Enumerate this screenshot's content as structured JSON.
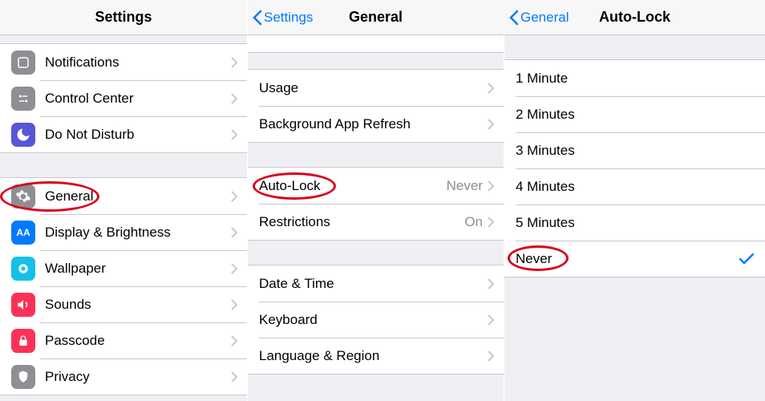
{
  "pane1": {
    "title": "Settings",
    "group1": [
      {
        "icon": "notifications-icon",
        "bg": "#fe3b30",
        "glyph_bg": "#8e8e93",
        "label": "Notifications"
      },
      {
        "icon": "control-center-icon",
        "bg": "#8e8e93",
        "label": "Control Center"
      },
      {
        "icon": "dnd-icon",
        "bg": "#5856d6",
        "label": "Do Not Disturb"
      }
    ],
    "group2": [
      {
        "icon": "general-icon",
        "bg": "#8e8e93",
        "label": "General",
        "circled": true
      },
      {
        "icon": "display-icon",
        "bg": "#007aff",
        "label": "Display & Brightness"
      },
      {
        "icon": "wallpaper-icon",
        "bg": "#14c0e8",
        "label": "Wallpaper"
      },
      {
        "icon": "sounds-icon",
        "bg": "#fc3158",
        "label": "Sounds"
      },
      {
        "icon": "passcode-icon",
        "bg": "#fc3158",
        "label": "Passcode"
      },
      {
        "icon": "privacy-icon",
        "bg": "#8e8e93",
        "label": "Privacy"
      }
    ]
  },
  "pane2": {
    "back": "Settings",
    "title": "General",
    "group1": [
      {
        "label": "Usage"
      },
      {
        "label": "Background App Refresh"
      }
    ],
    "group2": [
      {
        "label": "Auto-Lock",
        "value": "Never",
        "circled": true
      },
      {
        "label": "Restrictions",
        "value": "On"
      }
    ],
    "group3": [
      {
        "label": "Date & Time"
      },
      {
        "label": "Keyboard"
      },
      {
        "label": "Language & Region"
      }
    ]
  },
  "pane3": {
    "back": "General",
    "title": "Auto-Lock",
    "options": [
      {
        "label": "1 Minute",
        "selected": false
      },
      {
        "label": "2 Minutes",
        "selected": false
      },
      {
        "label": "3 Minutes",
        "selected": false
      },
      {
        "label": "4 Minutes",
        "selected": false
      },
      {
        "label": "5 Minutes",
        "selected": false
      },
      {
        "label": "Never",
        "selected": true,
        "circled": true
      }
    ]
  }
}
